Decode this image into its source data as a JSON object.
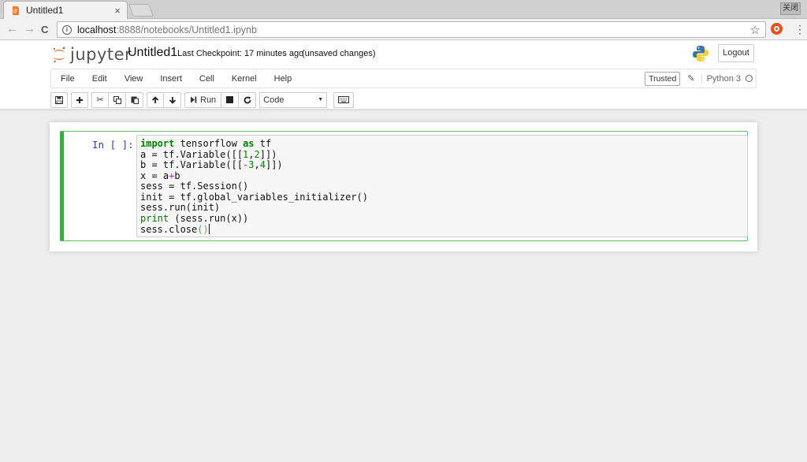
{
  "browser": {
    "tab_title": "Untitled1",
    "tab_close": "×",
    "window_button": "关闭",
    "url_host": "localhost",
    "url_path": ":8888/notebooks/Untitled1.ipynb",
    "back_icon": "←",
    "forward_icon": "→",
    "reload_icon": "C",
    "star_icon": "☆",
    "menu_icon": "⋮",
    "info_icon": "i"
  },
  "header": {
    "logo_text": "jupyter",
    "notebook_name": "Untitled1",
    "checkpoint": "Last Checkpoint: 17 minutes ago",
    "unsaved": "(unsaved changes)",
    "logout_label": "Logout"
  },
  "menu": {
    "items": [
      "File",
      "Edit",
      "View",
      "Insert",
      "Cell",
      "Kernel",
      "Help"
    ],
    "trusted_label": "Trusted",
    "kernel_name": "Python 3"
  },
  "toolbar": {
    "run_label": "Run",
    "cell_type": "Code"
  },
  "cell": {
    "prompt": "In [ ]:",
    "code": [
      "import tensorflow as tf",
      "a = tf.Variable([[1,2]])",
      "b = tf.Variable([[-3,4]])",
      "x = a+b",
      "sess = tf.Session()",
      "init = tf.global_variables_initializer()",
      "sess.run(init)",
      "print (sess.run(x))",
      "sess.close()"
    ]
  },
  "colors": {
    "cell_border_active": "#42a84b",
    "prompt": "#303f9f",
    "keyword": "#008000"
  }
}
